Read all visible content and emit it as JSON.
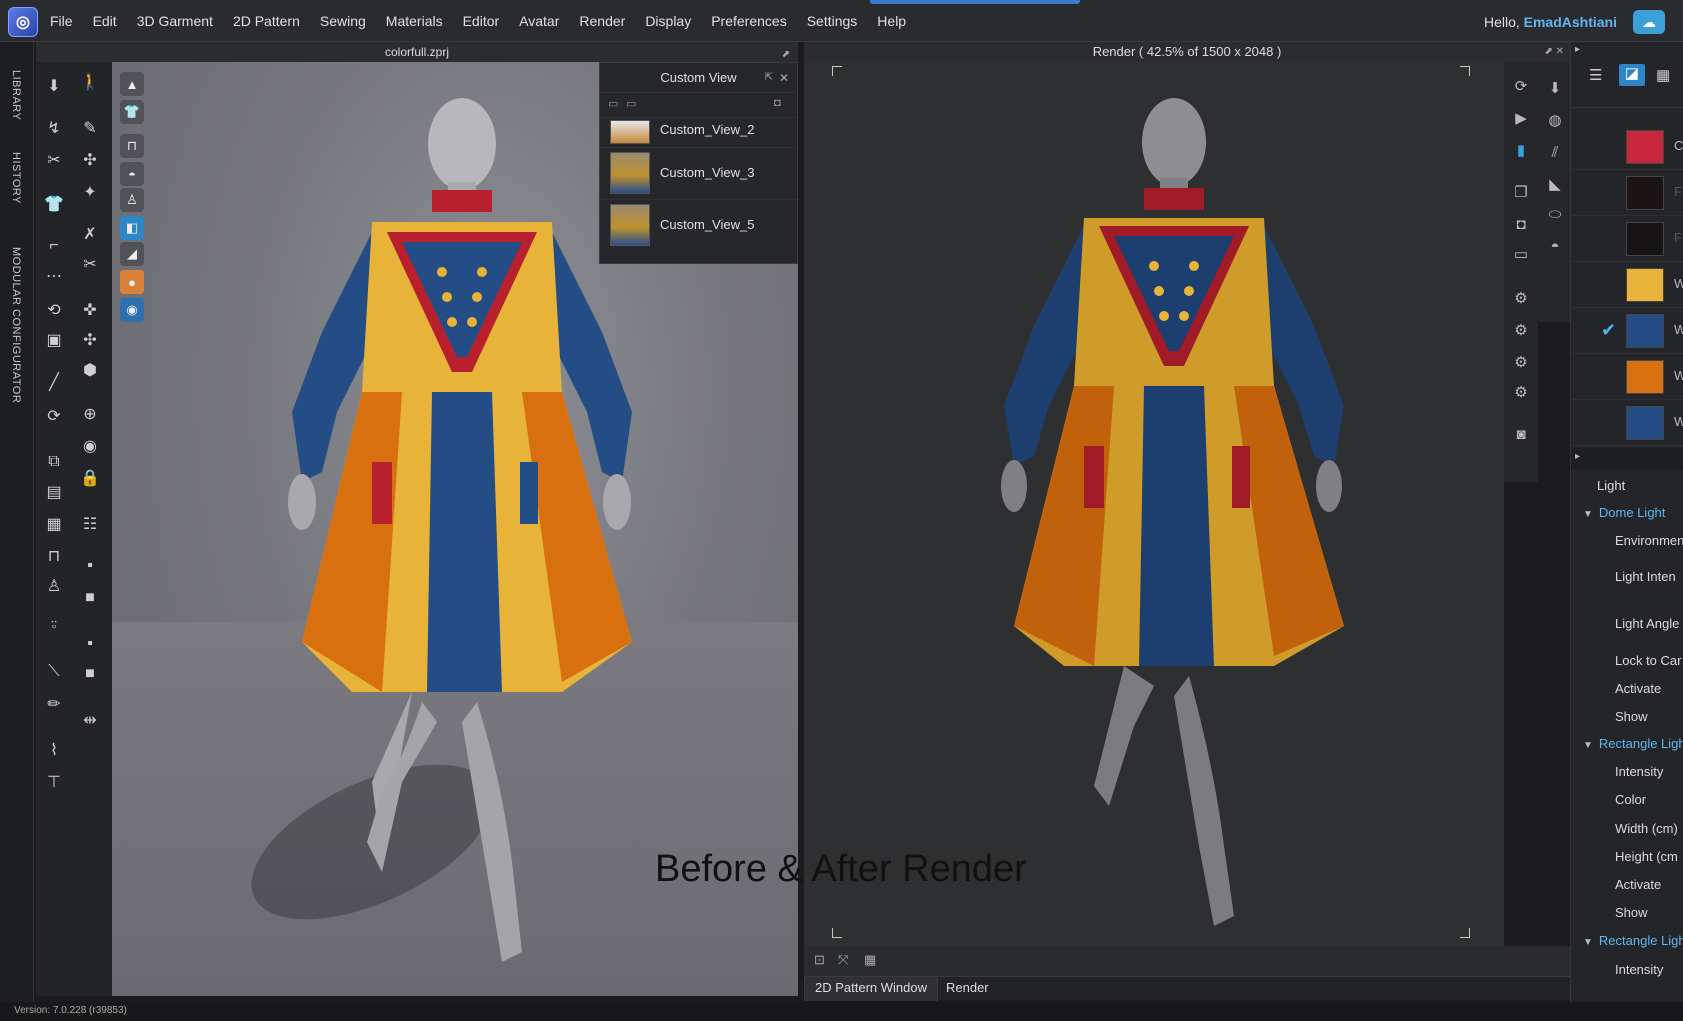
{
  "menubar": {
    "logo_icon": "clo-logo-icon",
    "items": [
      "File",
      "Edit",
      "3D Garment",
      "2D Pattern",
      "Sewing",
      "Materials",
      "Editor",
      "Avatar",
      "Render",
      "Display",
      "Preferences",
      "Settings",
      "Help"
    ],
    "greeting": "Hello,",
    "username": "EmadAshtiani",
    "cloud_icon": "cloud-icon"
  },
  "side_tabs": [
    "LIBRARY",
    "HISTORY",
    "MODULAR CONFIGURATOR"
  ],
  "viewport_3d": {
    "title": "colorfull.zprj"
  },
  "custom_view": {
    "title": "Custom View",
    "items": [
      {
        "label": "Custom_View_2"
      },
      {
        "label": "Custom_View_3"
      },
      {
        "label": "Custom_View_5"
      }
    ]
  },
  "render_view": {
    "title": "Render ( 42.5% of 1500 x 2048 )"
  },
  "bottom_tabs": [
    {
      "label": "2D Pattern Window",
      "active": true
    },
    {
      "label": "Render",
      "active": false
    }
  ],
  "caption": "Before & After Render",
  "status": {
    "version": "Version: 7.0.228 (r39853)"
  },
  "property_panel": {
    "swatches": [
      {
        "color": "#c8263a",
        "label": "C",
        "checked": false
      },
      {
        "color": "#1a1414",
        "label": "F",
        "checked": false
      },
      {
        "color": "#161414",
        "label": "F",
        "checked": false
      },
      {
        "color": "#e7b338",
        "label": "W",
        "checked": false
      },
      {
        "color": "#244d85",
        "label": "W",
        "checked": true
      },
      {
        "color": "#d8700f",
        "label": "W",
        "checked": false
      },
      {
        "color": "#244d85",
        "label": "W",
        "checked": false
      }
    ],
    "section_light": "Light",
    "dome_light": "Dome Light",
    "dome_props": [
      "Environmen",
      "Light Inten",
      "Light Angle",
      "Lock to Car",
      "Activate",
      "Show"
    ],
    "rect_light_1": "Rectangle Ligh",
    "rect_props": [
      "Intensity",
      "Color",
      "Width (cm)",
      "Height (cm",
      "Activate",
      "Show"
    ],
    "rect_light_2": "Rectangle Ligh",
    "rect2_props": [
      "Intensity"
    ]
  },
  "colors": {
    "accent": "#5fb6f0",
    "garment_yellow": "#e7b338",
    "garment_blue": "#244d85",
    "garment_orange": "#d8700f",
    "garment_red": "#b8202e"
  }
}
